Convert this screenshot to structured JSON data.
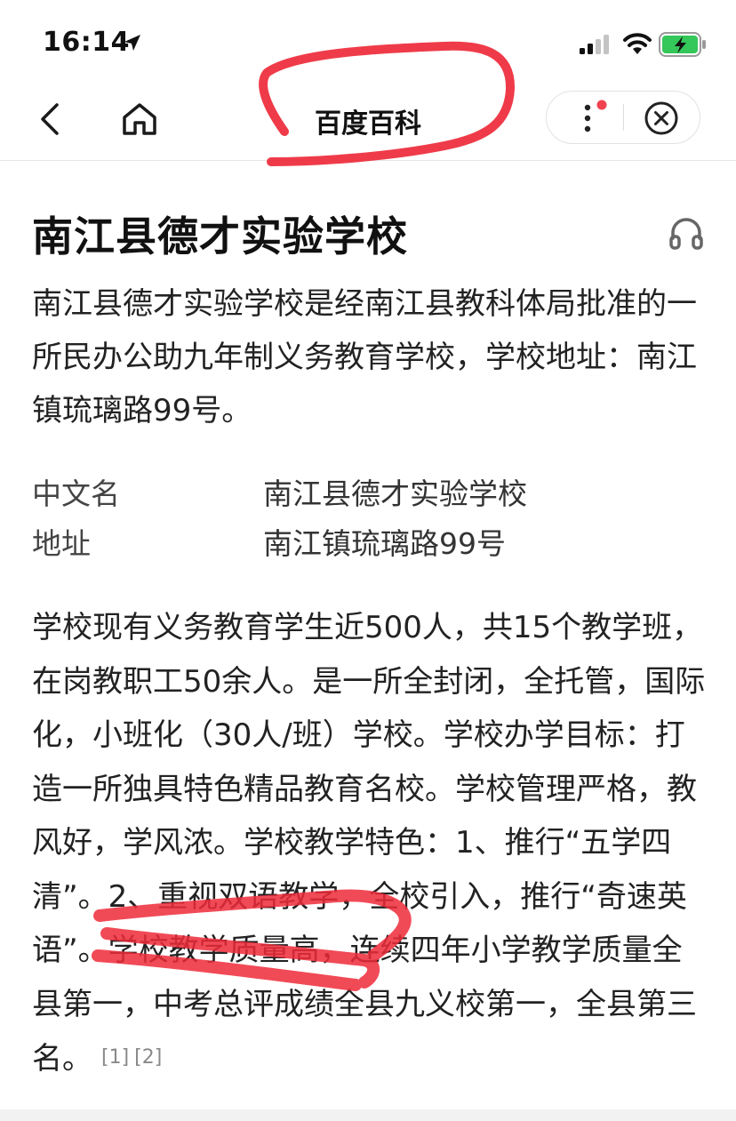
{
  "status": {
    "time": "16:14"
  },
  "nav": {
    "title": "百度百科"
  },
  "article": {
    "title": "南江县德才实验学校",
    "summary": "南江县德才实验学校是经南江县教科体局批准的一所民办公助九年制义务教育学校，学校地址：南江镇琉璃路99号。",
    "info": [
      {
        "label": "中文名",
        "value": "南江县德才实验学校"
      },
      {
        "label": "地址",
        "value": "南江镇琉璃路99号"
      }
    ],
    "body": "学校现有义务教育学生近500人，共15个教学班，在岗教职工50余人。是一所全封闭，全托管，国际化，小班化（30人/班）学校。学校办学目标：打造一所独具特色精品教育名校。学校管理严格，教风好，学风浓。学校教学特色：1、推行“五学四清”。2、重视双语教学，全校引入，推行“奇速英语”。学校教学质量高，连续四年小学教学质量全县第一，中考总评成绩全县九义校第一，全县第三名。",
    "refs": [
      "[1]",
      "[2]"
    ]
  },
  "icons": {
    "back": "chevron-left-icon",
    "home": "home-icon",
    "more": "more-vertical-icon",
    "close": "close-circle-icon",
    "listen": "headphones-icon"
  },
  "colors": {
    "annotation": "#ee2a3a",
    "notification_dot": "#f0434f",
    "battery": "#34c759"
  }
}
